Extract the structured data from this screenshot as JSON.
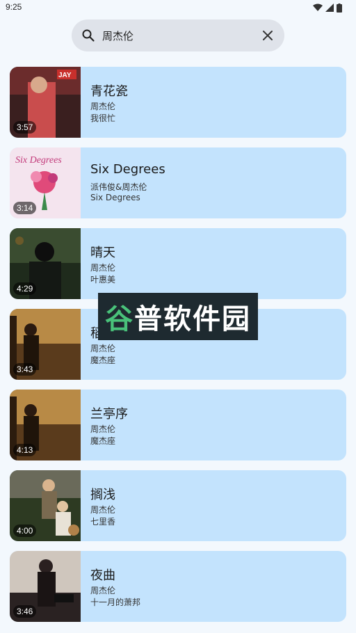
{
  "status_bar": {
    "time": "9:25"
  },
  "search": {
    "query": "周杰伦"
  },
  "songs": [
    {
      "title": "青花瓷",
      "artist": "周杰伦",
      "album": "我很忙",
      "duration": "3:57",
      "cover_color": "#8a3a3c"
    },
    {
      "title": "Six Degrees",
      "artist": "派伟俊&周杰伦",
      "album": "Six Degrees",
      "duration": "3:14",
      "cover_color": "#f3d9e6"
    },
    {
      "title": "晴天",
      "artist": "周杰伦",
      "album": "叶惠美",
      "duration": "4:29",
      "cover_color": "#2c3e2a"
    },
    {
      "title": "稻香",
      "artist": "周杰伦",
      "album": "魔杰座",
      "duration": "3:43",
      "cover_color": "#7a5228"
    },
    {
      "title": "兰亭序",
      "artist": "周杰伦",
      "album": "魔杰座",
      "duration": "4:13",
      "cover_color": "#7a5228"
    },
    {
      "title": "搁浅",
      "artist": "周杰伦",
      "album": "七里香",
      "duration": "4:00",
      "cover_color": "#3b4a2b"
    },
    {
      "title": "夜曲",
      "artist": "周杰伦",
      "album": "十一月的萧邦",
      "duration": "3:46",
      "cover_color": "#2a2626"
    }
  ],
  "watermark": {
    "text_a": "谷",
    "text_b": "普软件园"
  }
}
